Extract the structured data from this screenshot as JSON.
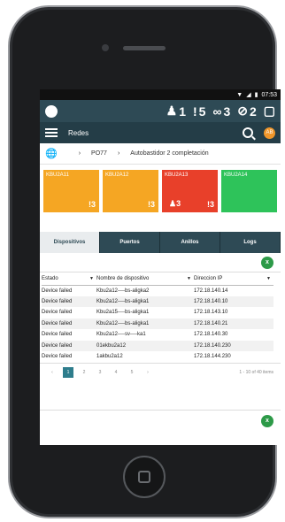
{
  "statusbar": {
    "time": "07:53"
  },
  "topbar": {
    "indicators": [
      {
        "icon": "person-alert-icon",
        "count": "1"
      },
      {
        "icon": "alert-icon",
        "count": "5"
      },
      {
        "icon": "link-icon",
        "count": "3"
      },
      {
        "icon": "broken-link-icon",
        "count": "2"
      }
    ]
  },
  "nav": {
    "title": "Redes",
    "avatar": "AB"
  },
  "breadcrumb": {
    "items": [
      "PO77",
      "Autobastidor 2 completación"
    ]
  },
  "tiles": [
    {
      "label": "KBU2A11",
      "color": "#f5a623",
      "count": "3"
    },
    {
      "label": "KBU2A12",
      "color": "#f5a623",
      "count": "3"
    },
    {
      "label": "KBU2A13",
      "color": "#e8402a",
      "count_a": "3",
      "count_b": "3"
    },
    {
      "label": "KBU2A14",
      "color": "#2ec35a"
    }
  ],
  "tabs": [
    "Dispositivos",
    "Puertos",
    "Anillos",
    "Logs"
  ],
  "table": {
    "headers": [
      "Estado",
      "Nombre de dispositivo",
      "Direccion IP"
    ],
    "rows": [
      [
        "Device failed",
        "Kbu2a12----bs-aligka2",
        "172.18.140.14"
      ],
      [
        "Device failed",
        "Kbu2a12----bs-aligka1",
        "172.18.140.10"
      ],
      [
        "Device failed",
        "Kbu2a15----bs-aligka1",
        "172.18.143.10"
      ],
      [
        "Device failed",
        "Kbu2a12----bs-aligka1",
        "172.18.140.21"
      ],
      [
        "Device failed",
        "Kbu2a12----sv----ka1",
        "172.18.140.30"
      ],
      [
        "Device failed",
        "01ekbu2a12",
        "172.18.140.230"
      ],
      [
        "Device failed",
        "1akbu2a12",
        "172.18.144.230"
      ]
    ]
  },
  "pager": {
    "pages": [
      "1",
      "2",
      "3",
      "4",
      "5"
    ],
    "summary": "1 - 10 of 40 items"
  },
  "colors": {
    "header": "#2e4a55",
    "accent": "#2e7d8c",
    "excel": "#2d9a48"
  }
}
